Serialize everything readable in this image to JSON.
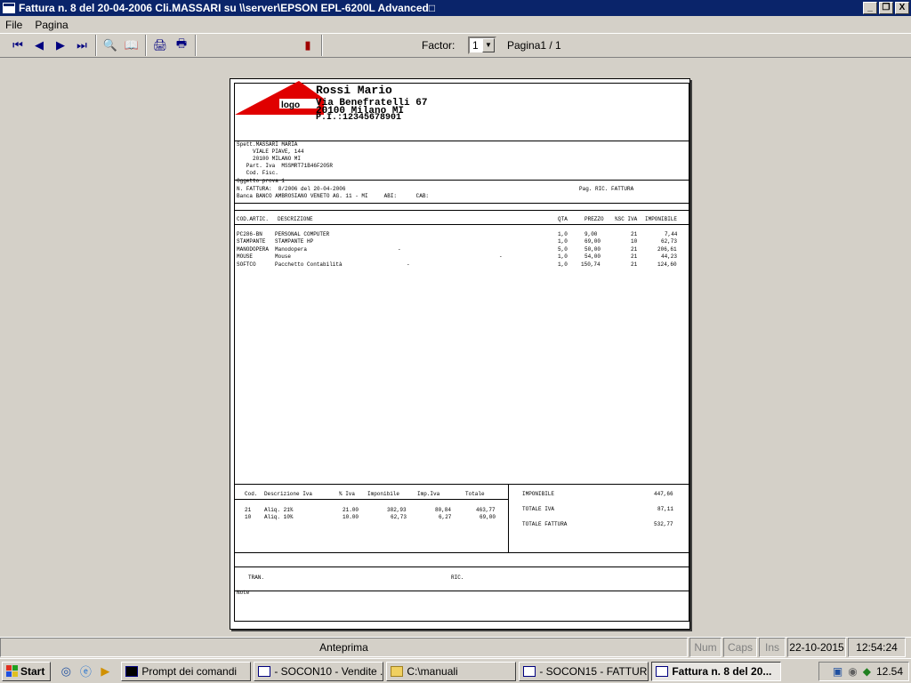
{
  "window": {
    "title": "Fattura n.  8 del 20-04-2006 Cli.MASSARI su \\\\server\\EPSON EPL-6200L Advanced□",
    "minimize": "_",
    "maximize": "❐",
    "close": "X"
  },
  "menu": {
    "file": "File",
    "pagina": "Pagina"
  },
  "toolbar": {
    "factor_label": "Factor:",
    "factor_value": "1",
    "page_info": "Pagina1 / 1"
  },
  "invoice": {
    "logo_text": "logo",
    "company": "Rossi Mario",
    "address": "Via Benefratelli 67",
    "city": "20100 Milano MI",
    "vat": "P.I.:12345678901",
    "customer_lines": [
      "Spett.MASSARI MARIA",
      "     VIALE PIAVE, 144",
      "     20100 MILANO MI",
      "   Part. Iva  MSSMRT71B46F205R",
      "   Cod. Fisc."
    ],
    "subject": "Oggetto prova 1",
    "invoice_line": "N. FATTURA:  8/2006 del 20-04-2006",
    "pag_label": "Pag. RIC. FATTURA",
    "bank_line": "Banca BANCO AMBROSIANO VENETO AG. 11 - MI     ABI:      CAB:",
    "headers": {
      "cod": "COD.ARTIC.",
      "desc": "DESCRIZIONE",
      "qta": "QTA",
      "prezzo": "PREZZO",
      "sc_iva": "%SC IVA",
      "imponibile": "IMPONIBILE"
    },
    "rows": [
      {
        "cod": "PC286-BN",
        "desc": "PERSONAL COMPUTER",
        "qta": "1,0",
        "prezzo": "9,00",
        "iva": "21",
        "imp": "7,44"
      },
      {
        "cod": "STAMPANTE",
        "desc": "STAMPANTE HP",
        "qta": "1,0",
        "prezzo": "69,00",
        "iva": "10",
        "imp": "62,73"
      },
      {
        "cod": "MANODOPERA",
        "desc": "Manodopera",
        "qta": "5,0",
        "prezzo": "50,00",
        "iva": "21",
        "imp": "206,61"
      },
      {
        "cod": "MOUSE",
        "desc": "Mouse",
        "qta": "1,0",
        "prezzo": "54,00",
        "iva": "21",
        "imp": "44,23"
      },
      {
        "cod": "SOFTCO",
        "desc": "Pacchetto Contabilità",
        "qta": "1,0",
        "prezzo": "150,74",
        "iva": "21",
        "imp": "124,60"
      }
    ],
    "dash_marks": [
      "-",
      "-",
      "-"
    ],
    "vat_headers": {
      "cod": "Cod.",
      "desc": "Descrizione Iva",
      "perc": "% Iva",
      "imp": "Imponibile",
      "impiva": "Imp.Iva",
      "tot": "Totale"
    },
    "vat_rows": [
      {
        "cod": "21",
        "desc": "Aliq. 21%",
        "perc": "21.00",
        "imp": "382,93",
        "impiva": "80,84",
        "tot": "463,77"
      },
      {
        "cod": "10",
        "desc": "Aliq. 10%",
        "perc": "10.00",
        "imp": "62,73",
        "impiva": "6,27",
        "tot": "69,00"
      }
    ],
    "totals": [
      {
        "label": "IMPONIBILE",
        "value": "447,66"
      },
      {
        "label": "TOTALE IVA",
        "value": "87,11"
      },
      {
        "label": "TOTALE FATTURA",
        "value": "532,77"
      }
    ],
    "tran_label": "TRAN.",
    "ric_label": "RIC.",
    "note_label": "Note"
  },
  "statusbar": {
    "mode": "Anteprima",
    "num": "Num",
    "caps": "Caps",
    "ins": "Ins",
    "date": "22-10-2015",
    "time": "12:54:24"
  },
  "taskbar": {
    "start": "Start",
    "tasks": [
      "Prompt dei comandi",
      "- SOCON10 - Vendite ...",
      "C:\\manuali",
      "- SOCON15 - FATTUR...",
      "Fattura n.  8 del 20..."
    ],
    "clock": "12.54"
  }
}
